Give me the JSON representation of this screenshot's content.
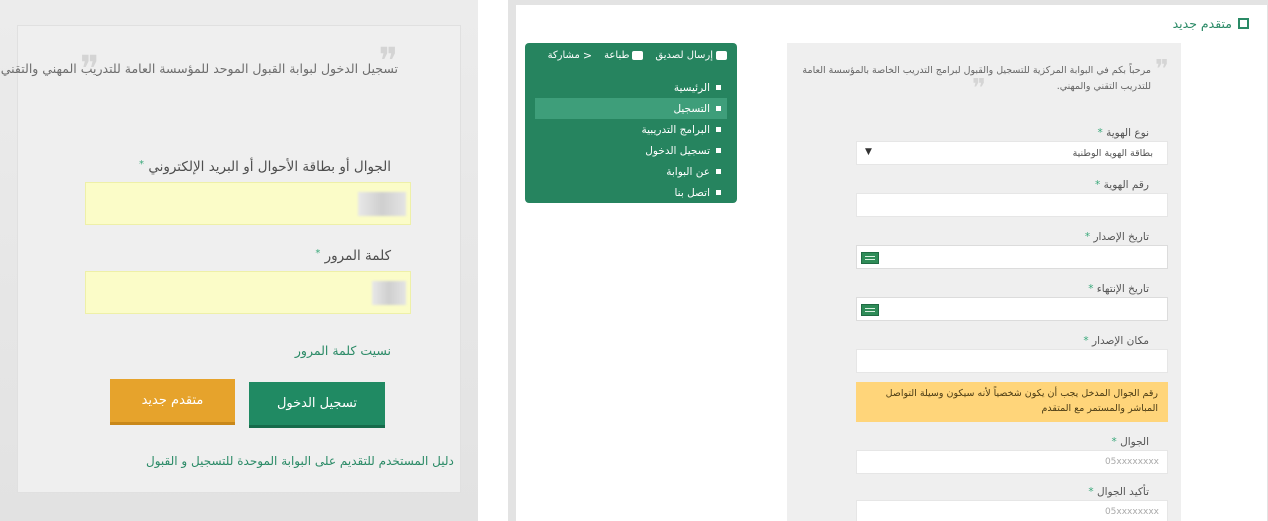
{
  "login": {
    "intro": "تسجيل الدخول لبوابة القبول الموحد للمؤسسة العامة للتدريب المهني والتقني",
    "username_label": "الجوال أو بطاقة الأحوال أو البريد الإلكتروني",
    "password_label": "كلمة المرور",
    "required_mark": "*",
    "forgot_link": "نسيت كلمة المرور",
    "login_button": "تسجيل الدخول",
    "new_applicant_button": "متقدم جديد",
    "guide_link": "دليل المستخدم للتقديم على البوابة الموحدة للتسجيل و القبول"
  },
  "registration": {
    "page_title": "متقدم جديد",
    "toolbar": {
      "send_friend": "إرسال لصديق",
      "print": "طباعة",
      "share": "مشاركة"
    },
    "menu": [
      {
        "label": "الرئيسية",
        "active": false
      },
      {
        "label": "التسجيل",
        "active": true
      },
      {
        "label": "البرامج التدريبية",
        "active": false
      },
      {
        "label": "تسجيل الدخول",
        "active": false
      },
      {
        "label": "عن البوابة",
        "active": false
      },
      {
        "label": "اتصل بنا",
        "active": false
      }
    ],
    "intro": "مرحباً بكم في البوابة المركزية للتسجيل والقبول لبرامج التدريب الخاصة بالمؤسسة العامة للتدريب التقني والمهني.",
    "fields": {
      "id_type_label": "نوع الهوية",
      "id_type_value": "بطاقة الهوية الوطنية",
      "id_number_label": "رقم الهوية",
      "issue_date_label": "تاريخ الإصدار",
      "expiry_date_label": "تاريخ الإنتهاء",
      "issue_place_label": "مكان الإصدار",
      "mobile_note": "رقم الجوال المدخل يجب أن يكون شخصياً لأنه سيكون وسيلة التواصل المباشر والمستمر مع المتقدم",
      "mobile_label": "الجوال",
      "mobile_placeholder": "05xxxxxxxx",
      "mobile_confirm_label": "تأكيد الجوال",
      "mobile_confirm_placeholder": "05xxxxxxxx"
    },
    "required_mark": "*"
  },
  "colors": {
    "primary_green": "#208a63",
    "accent_orange": "#e6a32c",
    "highlight_yellow": "#fbfcc8",
    "note_yellow": "#ffd57a"
  }
}
